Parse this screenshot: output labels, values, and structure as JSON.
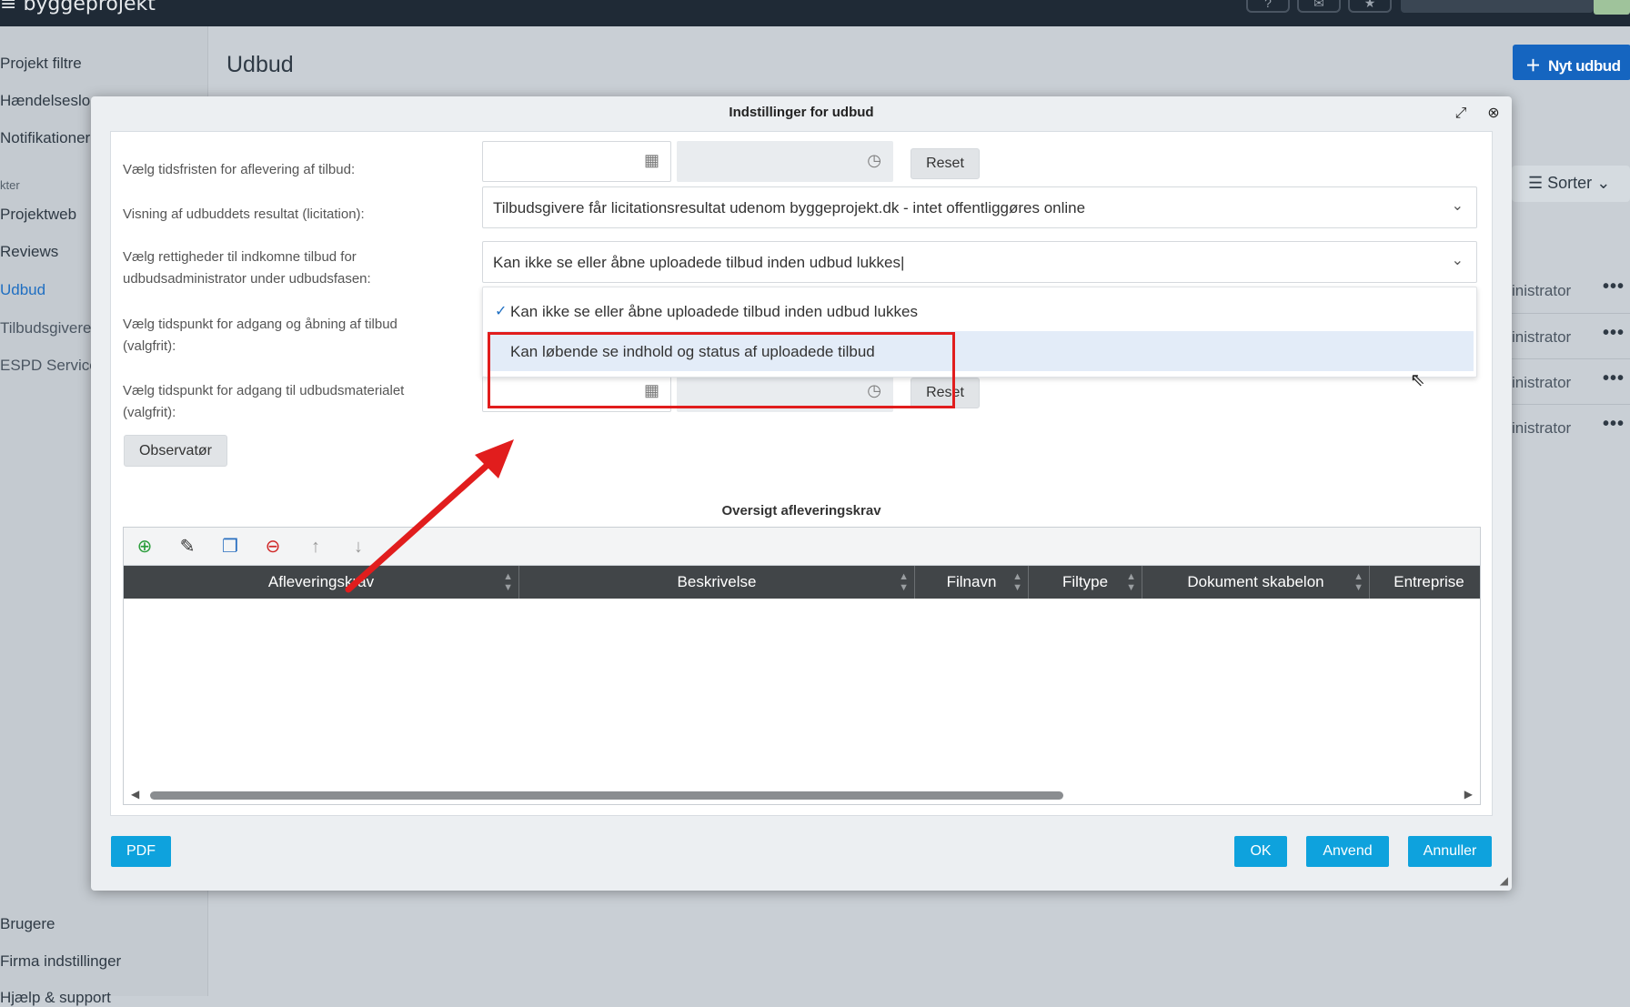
{
  "app": {
    "logo": "byggeprojekt",
    "top_icons": [
      "help-icon",
      "chat-icon",
      "bookmark-icon"
    ]
  },
  "sidebar": {
    "items": [
      {
        "label": "Projekt filtre"
      },
      {
        "label": "Hændelseslog"
      },
      {
        "label": "Notifikationer"
      },
      {
        "label": "Projektweb"
      },
      {
        "label": "Reviews"
      },
      {
        "label": "Udbud"
      },
      {
        "label": "Tilbudsgivere"
      },
      {
        "label": "ESPD Service"
      },
      {
        "label": "Brugere"
      },
      {
        "label": "Firma indstillinger"
      },
      {
        "label": "Hjælp & support"
      }
    ],
    "section_label": "kter"
  },
  "main": {
    "title": "Udbud",
    "new_button": "Nyt udbud",
    "sort_button": "Sorter",
    "rows": [
      {
        "role": "inistrator"
      },
      {
        "role": "inistrator"
      },
      {
        "role": "inistrator"
      },
      {
        "role": "inistrator"
      }
    ],
    "row_menu": "•••"
  },
  "dialog": {
    "title": "Indstillinger for udbud",
    "fields": {
      "deadline_label": "Vælg tidsfristen for aflevering af tilbud:",
      "result_label": "Visning af udbuddets resultat (licitation):",
      "rights_label": "Vælg rettigheder til indkomne tilbud for udbudsadministrator under udbudsfasen:",
      "opening_label": "Vælg tidspunkt for adgang og åbning af tilbud (valgfrit):",
      "material_label": "Vælg tidspunkt for adgang til udbudsmaterialet (valgfrit):"
    },
    "reset": "Reset",
    "result_value": "Tilbudsgivere får licitationsresultat udenom byggeprojekt.dk - intet offentliggøres online",
    "rights_value": "Kan ikke se eller åbne uploadede tilbud inden udbud lukkes",
    "dropdown_options": [
      {
        "label": "Kan ikke se eller åbne uploadede tilbud inden udbud lukkes"
      },
      {
        "label": "Kan løbende se indhold og status af uploadede tilbud"
      }
    ],
    "observer_button": "Observatør",
    "grid_title": "Oversigt afleveringskrav",
    "grid_columns": [
      "Afleveringskrav",
      "Beskrivelse",
      "Filnavn",
      "Filtype",
      "Dokument skabelon",
      "Entreprise"
    ],
    "footer": {
      "pdf": "PDF",
      "ok": "OK",
      "apply": "Anvend",
      "cancel": "Annuller"
    }
  },
  "colors": {
    "accent": "#0ea2dd",
    "primary": "#1565c0",
    "annotation": "#e11d1d"
  }
}
